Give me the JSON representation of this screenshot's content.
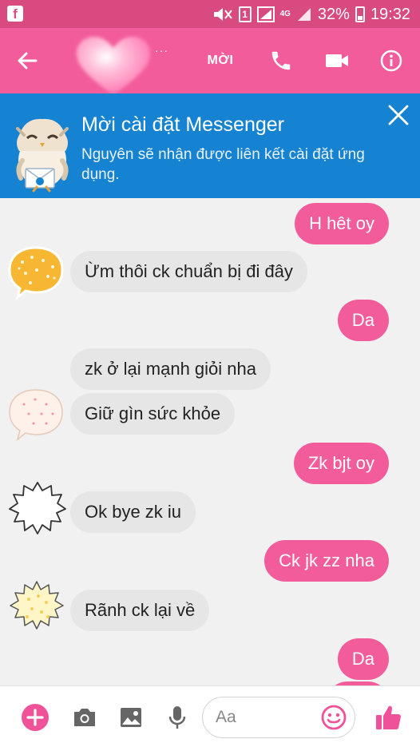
{
  "status_bar": {
    "app_badge": "f",
    "sim_slot": "1",
    "network": "4G",
    "battery": "32%",
    "time": "19:32"
  },
  "toolbar": {
    "title_suffix": "···",
    "invite_label": "MỜI"
  },
  "install_banner": {
    "title": "Mời cài đặt Messenger",
    "text": "Nguyên sẽ nhận được liên kết cài đặt ứng dụng."
  },
  "messages": [
    {
      "from": "me",
      "text": "H hêt oy"
    },
    {
      "from": "them",
      "text": "Ừm thôi ck chuẩn bị đi đây"
    },
    {
      "from": "me",
      "text": "Da"
    },
    {
      "from": "them",
      "text": "zk ở lại mạnh giỏi nha"
    },
    {
      "from": "them",
      "text": "Giữ gìn sức khỏe"
    },
    {
      "from": "me",
      "text": "Zk bjt oy"
    },
    {
      "from": "them",
      "text": "Ok bye zk iu"
    },
    {
      "from": "me",
      "text": "Ck jk zz nha"
    },
    {
      "from": "them",
      "text": "Rãnh ck lại về"
    },
    {
      "from": "me",
      "text": "Da"
    }
  ],
  "composer": {
    "placeholder": "Aa"
  },
  "colors": {
    "status_bar": "#d84a80",
    "toolbar": "#f25c9b",
    "banner": "#1683d2",
    "outgoing_bubble": "#f25c9b",
    "incoming_bubble": "#e6e6e6",
    "accent": "#f0529a"
  },
  "icons": [
    "back-arrow-icon",
    "phone-icon",
    "video-camera-icon",
    "info-icon",
    "close-icon",
    "plus-icon",
    "camera-icon",
    "image-icon",
    "microphone-icon",
    "emoji-icon",
    "thumbs-up-icon"
  ]
}
